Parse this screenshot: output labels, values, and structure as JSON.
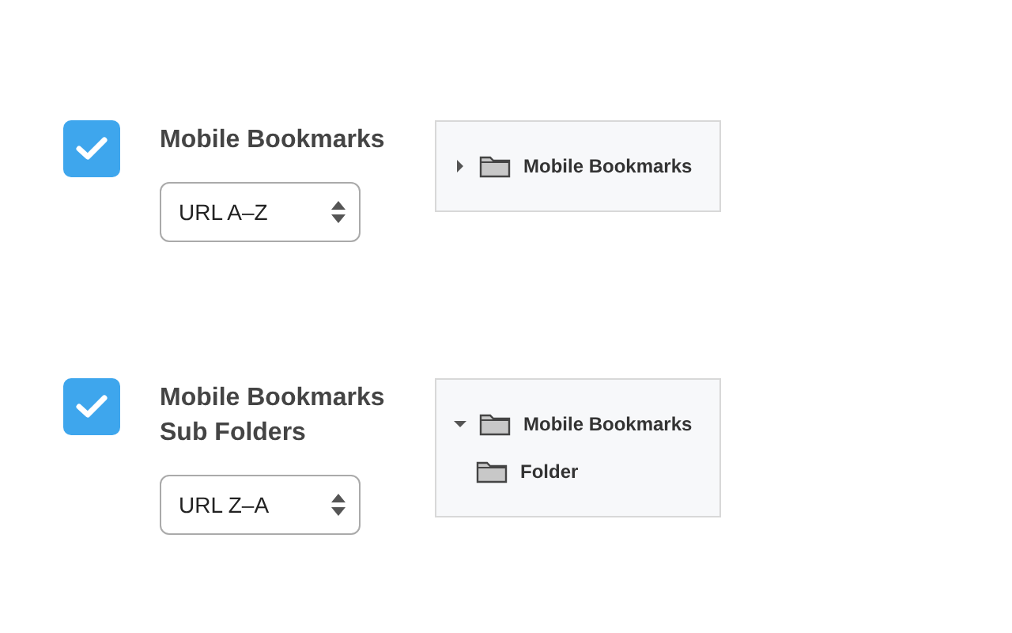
{
  "sections": [
    {
      "checked": true,
      "label": "Mobile Bookmarks",
      "sort": "URL A–Z",
      "tree": [
        {
          "name": "Mobile Bookmarks",
          "expanded": false
        }
      ]
    },
    {
      "checked": true,
      "label": "Mobile Bookmarks Sub Folders",
      "sort": "URL Z–A",
      "tree": [
        {
          "name": "Mobile Bookmarks",
          "expanded": true,
          "children": [
            {
              "name": "Folder"
            }
          ]
        }
      ]
    }
  ]
}
